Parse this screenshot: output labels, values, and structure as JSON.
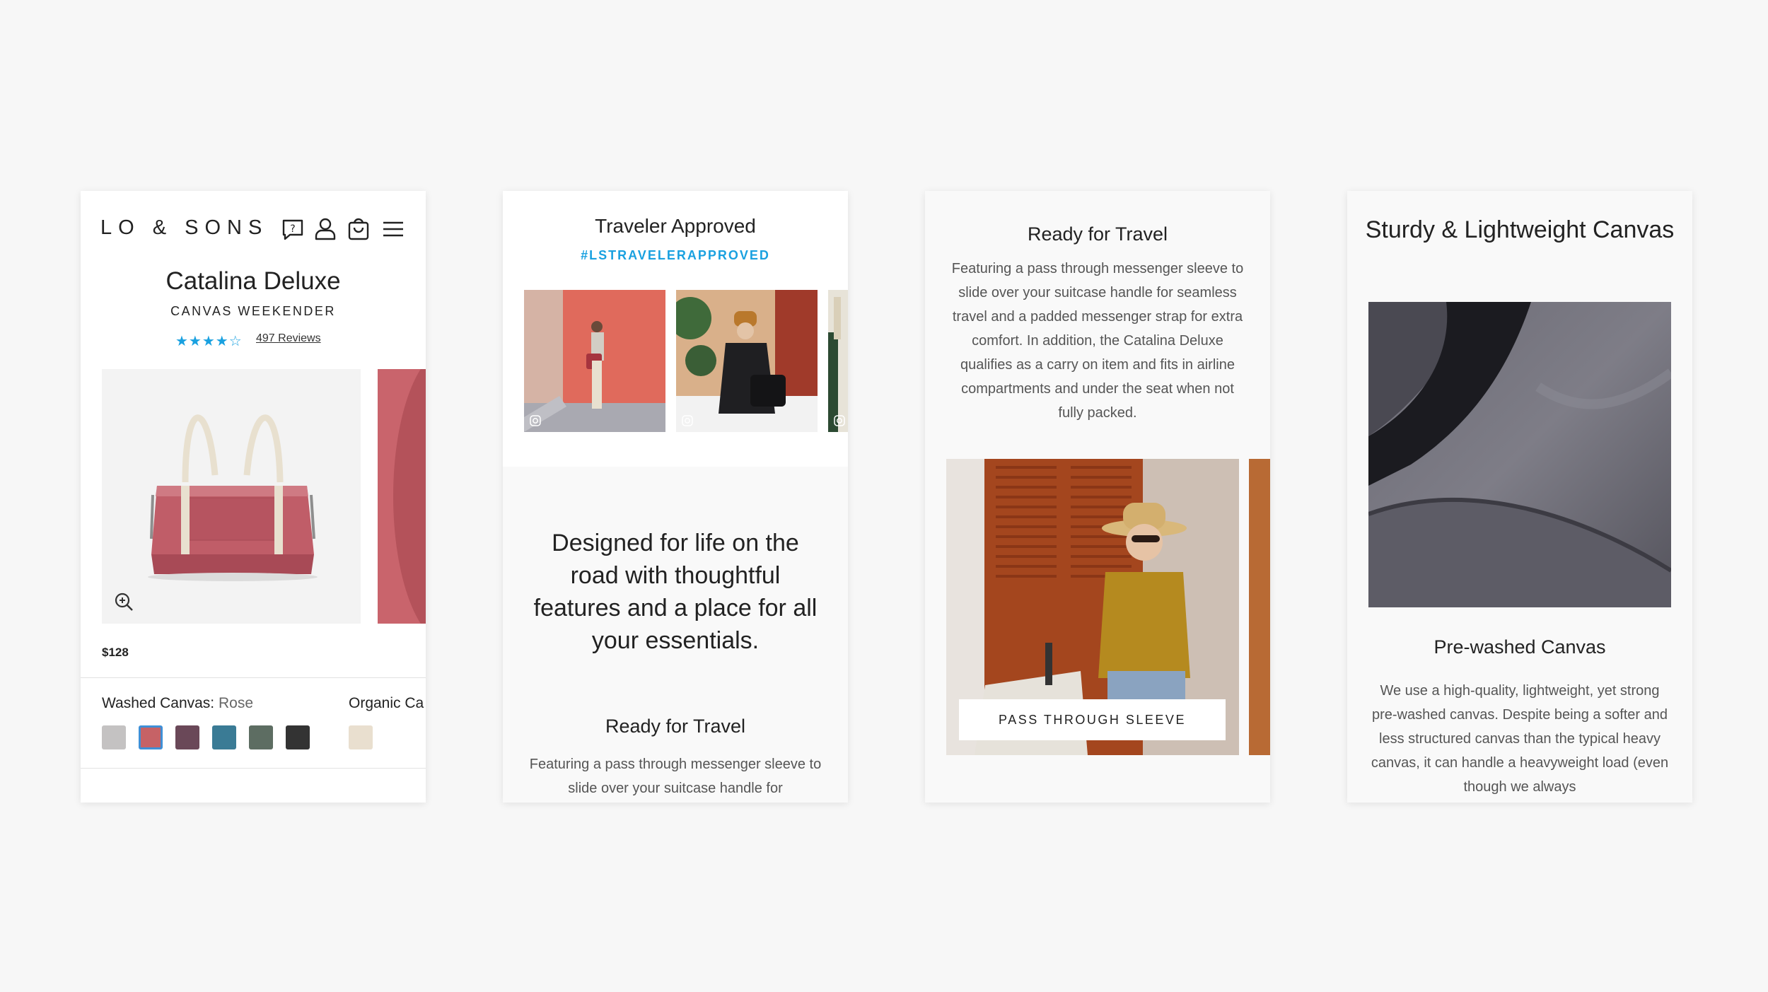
{
  "colors": {
    "accent": "#1aa1e0",
    "text": "#222222",
    "muted": "#555555",
    "background": "#f7f7f7"
  },
  "product_card": {
    "logo": "LO & SONS",
    "header_icons": [
      "help-icon",
      "account-icon",
      "cart-icon",
      "menu-icon"
    ],
    "title": "Catalina Deluxe",
    "subtitle": "CANVAS WEEKENDER",
    "rating": {
      "value": 4,
      "max": 5,
      "stars_text": "★★★★☆"
    },
    "reviews_link": "497 Reviews",
    "price": "$128",
    "swatch_group_1": {
      "label": "Washed Canvas:",
      "value": "Rose"
    },
    "swatch_group_2": {
      "label": "Organic Ca"
    },
    "swatches": [
      {
        "name": "grey",
        "color": "#c4c2c2"
      },
      {
        "name": "rose",
        "color": "#c66266",
        "selected": true
      },
      {
        "name": "plum",
        "color": "#6a4858"
      },
      {
        "name": "teal",
        "color": "#3a7b95"
      },
      {
        "name": "sage",
        "color": "#5d6d62"
      },
      {
        "name": "black",
        "color": "#333333"
      }
    ],
    "organic_swatch": {
      "name": "natural",
      "color": "#e9dfcf"
    }
  },
  "traveler_card": {
    "title": "Traveler Approved",
    "hashtag": "#LSTRAVELERAPPROVED",
    "headline": "Designed for life on the road with thoughtful features and a place for all your essentials.",
    "section_title": "Ready for Travel",
    "section_text": "Featuring a pass through messenger sleeve to slide over your suitcase handle for"
  },
  "travel_card": {
    "title": "Ready for Travel",
    "text": "Featuring a pass through messenger sleeve to slide over your suitcase handle for seamless travel and a padded messenger strap for extra comfort. In addition, the Catalina Deluxe qualifies as a carry on item and fits in airline compartments and under the seat when not fully packed.",
    "button": "PASS THROUGH SLEEVE"
  },
  "canvas_card": {
    "title": "Sturdy & Lightweight Canvas",
    "section_title": "Pre-washed Canvas",
    "text": "We use a high-quality, lightweight, yet strong pre-washed canvas. Despite being a softer and less structured canvas than the typical heavy canvas, it can handle a heavyweight load (even though we always"
  }
}
